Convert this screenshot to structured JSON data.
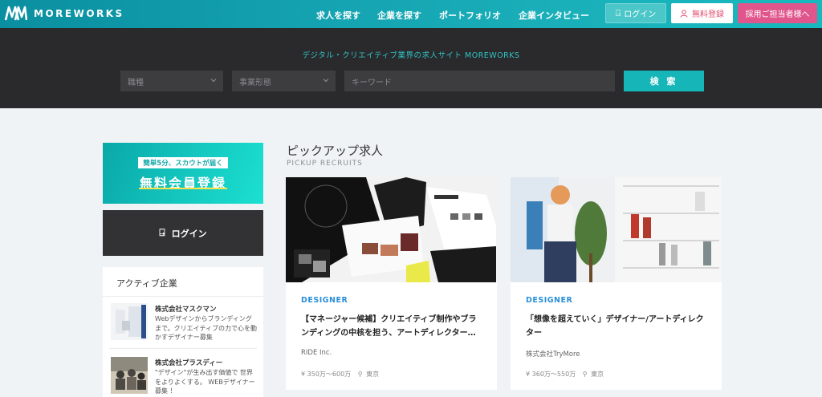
{
  "header": {
    "logo_text": "MOREWORKS",
    "nav": [
      "求人を探す",
      "企業を探す",
      "ポートフォリオ",
      "企業インタビュー"
    ],
    "login_label": "ログイン",
    "register_label": "無料登録",
    "corporate_label": "採用ご担当者様へ"
  },
  "search": {
    "tagline": "デジタル・クリエイティブ業界の求人サイト MOREWORKS",
    "job_placeholder": "職種",
    "type_placeholder": "事業形態",
    "keyword_placeholder": "キーワード",
    "button_label": "検 索"
  },
  "sidebar": {
    "promo_tag": "簡単5分、スカウトが届く",
    "promo_title": "無料会員登録",
    "login_label": "ログイン",
    "active_title": "アクティブ企業",
    "companies": [
      {
        "name": "株式会社マスクマン",
        "desc": "Webデザインからブランディングまで。クリエイティブの力で心を動かすデザイナー募集"
      },
      {
        "name": "株式会社プラスディー",
        "desc": "\"デザイン\"が生み出す価値で 世界をよりよくする。 WEBデザイナー募集 ！"
      }
    ]
  },
  "main": {
    "section_title": "ピックアップ求人",
    "section_sub": "PICKUP RECRUITS",
    "cards": [
      {
        "category": "DESIGNER",
        "title": "【マネージャー候補】クリエイティブ制作やブランディングの中核を担う、アートディレクター…",
        "company": "RIDE Inc.",
        "salary": "¥ 350万～600万",
        "location": "東京"
      },
      {
        "category": "DESIGNER",
        "title": "「想像を超えていく」デザイナー/アートディレクター",
        "company": "株式会社TryMore",
        "salary": "¥ 360万～550万",
        "location": "東京"
      }
    ]
  },
  "colors": {
    "accent": "#16b5b8",
    "pink": "#e0568c",
    "dark": "#2a2a2c"
  }
}
